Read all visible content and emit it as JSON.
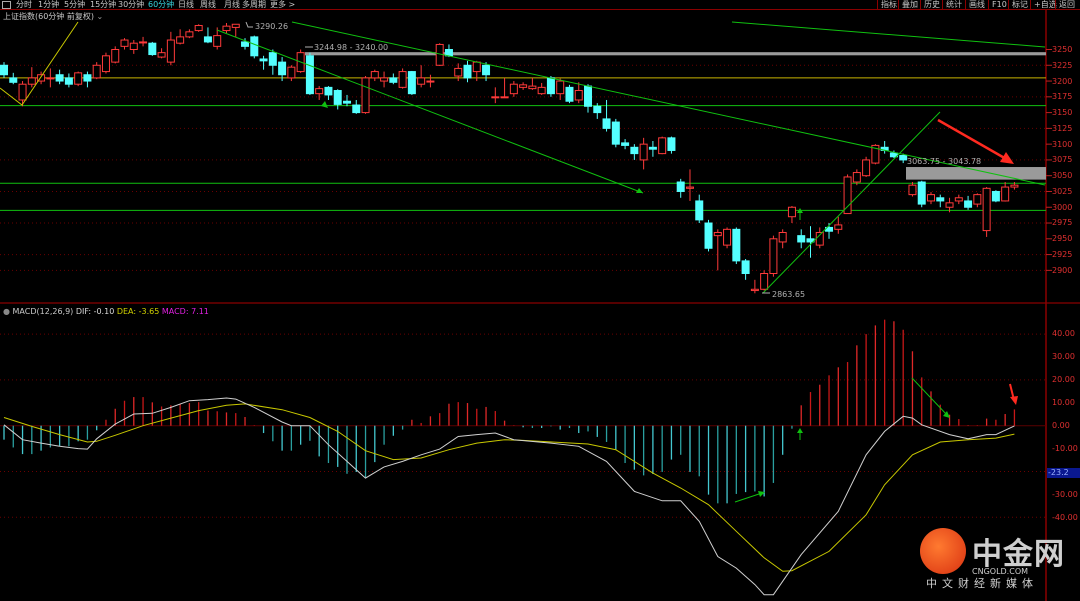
{
  "toolbar": {
    "tabs": [
      "分时",
      "1分钟",
      "5分钟",
      "15分钟",
      "30分钟",
      "60分钟",
      "日线",
      "周线",
      "月线",
      "多周期",
      "更多 >"
    ],
    "active_tab": "60分钟",
    "buttons": [
      "指标",
      "叠加",
      "历史",
      "统计",
      "画线",
      "F10",
      "标记",
      "+自选",
      "返回"
    ]
  },
  "title": "上证指数(60分钟 前复权)",
  "macd_legend": {
    "name": "MACD(12,26,9)",
    "dif": "DIF: -0.10",
    "dea": "DEA: -3.65",
    "macd": "MACD: 7.11"
  },
  "annotations": {
    "high": "3290.26",
    "band": "3244.98 - 3240.00",
    "box": "3063.75 - 3043.78",
    "low": "2863.65"
  },
  "price_axis": [
    "3250",
    "3225",
    "3200",
    "3175",
    "3150",
    "3125",
    "3100",
    "3075",
    "3050",
    "3025",
    "3000",
    "2975",
    "2950",
    "2925",
    "2900"
  ],
  "macd_axis": [
    "40.00",
    "30.00",
    "20.00",
    "10.00",
    "0.00",
    "-10.00",
    "-30.00",
    "-40.00"
  ],
  "macd_axis_highlight": "-23.2",
  "watermark": {
    "brand": "中金网",
    "site": "CNGOLD.COM",
    "slogan": "中文财经新媒体"
  },
  "colors": {
    "up": "#ff3a3a",
    "down": "#54ffff",
    "dif": "#d0d0d0",
    "dea": "#c8c800",
    "trend": "#10c010",
    "arrow": "#ff2a20"
  },
  "chart_data": [
    {
      "type": "candlestick",
      "title": "上证指数(60分钟 前复权)",
      "ylim": [
        2860,
        3300
      ],
      "ohlc_format": "[open, close, high, low]",
      "candles": [
        [
          3225,
          3210,
          3230,
          3205
        ],
        [
          3205,
          3198,
          3213,
          3195
        ],
        [
          3170,
          3195,
          3200,
          3160
        ],
        [
          3195,
          3205,
          3222,
          3190
        ],
        [
          3200,
          3210,
          3215,
          3195
        ],
        [
          3205,
          3205,
          3220,
          3190
        ],
        [
          3210,
          3200,
          3218,
          3195
        ],
        [
          3205,
          3195,
          3212,
          3190
        ],
        [
          3195,
          3213,
          3215,
          3192
        ],
        [
          3210,
          3200,
          3215,
          3190
        ],
        [
          3205,
          3225,
          3230,
          3203
        ],
        [
          3215,
          3240,
          3245,
          3212
        ],
        [
          3230,
          3250,
          3255,
          3228
        ],
        [
          3255,
          3265,
          3268,
          3250
        ],
        [
          3250,
          3260,
          3265,
          3243
        ],
        [
          3262,
          3262,
          3270,
          3255
        ],
        [
          3260,
          3242,
          3262,
          3240
        ],
        [
          3238,
          3245,
          3252,
          3236
        ],
        [
          3230,
          3265,
          3278,
          3225
        ],
        [
          3260,
          3270,
          3282,
          3258
        ],
        [
          3270,
          3278,
          3282,
          3268
        ],
        [
          3280,
          3288,
          3290,
          3278
        ],
        [
          3270,
          3262,
          3285,
          3260
        ],
        [
          3255,
          3272,
          3285,
          3250
        ],
        [
          3280,
          3287,
          3292,
          3276
        ],
        [
          3285,
          3290,
          3290.26,
          3270
        ],
        [
          3262,
          3255,
          3268,
          3250
        ],
        [
          3270,
          3240,
          3272,
          3236
        ],
        [
          3235,
          3232,
          3240,
          3218
        ],
        [
          3245,
          3225,
          3250,
          3210
        ],
        [
          3230,
          3210,
          3238,
          3200
        ],
        [
          3205,
          3222,
          3225,
          3200
        ],
        [
          3215,
          3245,
          3250,
          3213
        ],
        [
          3240,
          3180,
          3244.98,
          3178
        ],
        [
          3180,
          3188,
          3192,
          3170
        ],
        [
          3190,
          3178,
          3192,
          3170
        ],
        [
          3185,
          3163,
          3187,
          3155
        ],
        [
          3168,
          3165,
          3178,
          3160
        ],
        [
          3162,
          3150,
          3170,
          3148
        ],
        [
          3150,
          3205,
          3208,
          3148
        ],
        [
          3205,
          3215,
          3218,
          3200
        ],
        [
          3200,
          3205,
          3215,
          3190
        ],
        [
          3205,
          3198,
          3212,
          3195
        ],
        [
          3190,
          3215,
          3220,
          3188
        ],
        [
          3215,
          3180,
          3216,
          3178
        ],
        [
          3195,
          3205,
          3225,
          3190
        ],
        [
          3200,
          3200,
          3210,
          3190
        ],
        [
          3225,
          3258,
          3260,
          3224
        ],
        [
          3250,
          3240,
          3258,
          3238
        ],
        [
          3208,
          3220,
          3228,
          3200
        ],
        [
          3225,
          3205,
          3232,
          3198
        ],
        [
          3215,
          3230,
          3232,
          3200
        ],
        [
          3225,
          3210,
          3230,
          3200
        ],
        [
          3175,
          3175,
          3190,
          3165
        ],
        [
          3175,
          3175,
          3205,
          3175
        ],
        [
          3180,
          3195,
          3200,
          3175
        ],
        [
          3190,
          3194,
          3198,
          3186
        ],
        [
          3188,
          3192,
          3205,
          3186
        ],
        [
          3180,
          3190,
          3197,
          3178
        ],
        [
          3205,
          3180,
          3208,
          3175
        ],
        [
          3180,
          3200,
          3204,
          3170
        ],
        [
          3190,
          3168,
          3194,
          3165
        ],
        [
          3170,
          3185,
          3198,
          3165
        ],
        [
          3192,
          3160,
          3195,
          3150
        ],
        [
          3160,
          3150,
          3165,
          3140
        ],
        [
          3140,
          3125,
          3170,
          3120
        ],
        [
          3135,
          3100,
          3140,
          3095
        ],
        [
          3102,
          3098,
          3108,
          3092
        ],
        [
          3095,
          3085,
          3100,
          3075
        ],
        [
          3075,
          3100,
          3110,
          3060
        ],
        [
          3095,
          3092,
          3105,
          3080
        ],
        [
          3085,
          3110,
          3112,
          3084
        ],
        [
          3110,
          3090,
          3112,
          3085
        ],
        [
          3040,
          3025,
          3045,
          3015
        ],
        [
          3030,
          3032,
          3060,
          3010
        ],
        [
          3010,
          2980,
          3020,
          2975
        ],
        [
          2975,
          2935,
          2980,
          2930
        ],
        [
          2955,
          2960,
          2965,
          2900
        ],
        [
          2940,
          2965,
          2968,
          2935
        ],
        [
          2965,
          2915,
          2968,
          2910
        ],
        [
          2915,
          2895,
          2918,
          2885
        ],
        [
          2868,
          2870,
          2885,
          2863.65
        ],
        [
          2870,
          2895,
          2900,
          2868
        ],
        [
          2895,
          2950,
          2955,
          2890
        ],
        [
          2945,
          2960,
          2965,
          2935
        ],
        [
          2985,
          3000,
          3002,
          2975
        ],
        [
          2955,
          2945,
          2965,
          2935
        ],
        [
          2950,
          2945,
          2970,
          2920
        ],
        [
          2940,
          2960,
          2968,
          2935
        ],
        [
          2968,
          2962,
          2975,
          2950
        ],
        [
          2965,
          2972,
          2985,
          2958
        ],
        [
          2990,
          3048,
          3052,
          2990
        ],
        [
          3040,
          3055,
          3060,
          3035
        ],
        [
          3050,
          3075,
          3080,
          3048
        ],
        [
          3070,
          3098,
          3100,
          3068
        ],
        [
          3095,
          3090,
          3105,
          3085
        ],
        [
          3086,
          3080,
          3090,
          3078
        ],
        [
          3082,
          3075,
          3085,
          3070
        ],
        [
          3020,
          3035,
          3040,
          3017
        ],
        [
          3040,
          3005,
          3042,
          3000
        ],
        [
          3010,
          3020,
          3024,
          3005
        ],
        [
          3015,
          3010,
          3020,
          3000
        ],
        [
          3000,
          3007,
          3015,
          2992
        ],
        [
          3010,
          3015,
          3020,
          3005
        ],
        [
          3010,
          3000,
          3018,
          2996
        ],
        [
          3005,
          3020,
          3022,
          3000
        ],
        [
          2963,
          3030,
          3032,
          2953
        ],
        [
          3025,
          3010,
          3027,
          3008
        ],
        [
          3010,
          3032,
          3040,
          3009
        ],
        [
          3032,
          3035,
          3040,
          3028
        ]
      ],
      "horizontal_levels": [
        {
          "price": 3205,
          "color": "#c8b400"
        },
        {
          "price": 3161,
          "color": "#10c010"
        },
        {
          "price": 3038,
          "color": "#10c010"
        },
        {
          "price": 2995,
          "color": "#10c010"
        }
      ],
      "zones": [
        {
          "from": 3240.0,
          "to": 3244.98,
          "color": "#9a9a9a"
        },
        {
          "from": 3043.78,
          "to": 3063.75,
          "color": "#9a9a9a"
        }
      ]
    },
    {
      "type": "macd",
      "title": "MACD(12,26,9)",
      "ylim": [
        -50,
        50
      ],
      "histogram": [
        -6.1,
        -9.5,
        -12.4,
        -12.4,
        -10.9,
        -9.5,
        -9,
        -9,
        -6.8,
        -6.1,
        -2,
        2.6,
        7.4,
        10.9,
        12.5,
        12.5,
        10.2,
        8.4,
        8.9,
        9.5,
        9.9,
        10.3,
        6.6,
        6.3,
        5.8,
        5.5,
        3.8,
        0.2,
        -3.2,
        -6.8,
        -10.9,
        -10.9,
        -8.3,
        -6.6,
        -13.4,
        -16.3,
        -18,
        -21,
        -20.2,
        -22.6,
        -15.9,
        -8.3,
        -4.4,
        -1.7,
        2.6,
        1.2,
        4.1,
        5.5,
        9.6,
        10.3,
        9.9,
        7.4,
        8.2,
        6.4,
        2.2,
        0.2,
        -0.7,
        -1,
        -1,
        -0.3,
        -1.7,
        -1,
        -3.2,
        -2.5,
        -4.9,
        -7.1,
        -10.5,
        -16.3,
        -19.2,
        -21.7,
        -21.1,
        -20.2,
        -14.8,
        -12.7,
        -20.2,
        -22.1,
        -30.1,
        -33.9,
        -33.9,
        -29.8,
        -29,
        -28.7,
        -30.9,
        -25,
        -12.7,
        -1.3,
        8.9,
        14.7,
        17.9,
        22,
        25.5,
        27.8,
        35.1,
        40,
        43.8,
        46.3,
        45.6,
        41.9,
        32.5,
        21.1,
        15,
        9.2,
        4.8,
        2.9,
        0.2,
        0.2,
        3.1,
        2.6,
        5.1,
        7.11
      ],
      "dif": [
        [
          0,
          0.4
        ],
        [
          2,
          -6.1
        ],
        [
          4,
          -7.6
        ],
        [
          6,
          -9
        ],
        [
          8,
          -10
        ],
        [
          9,
          -10.2
        ],
        [
          10,
          -5.7
        ],
        [
          12,
          0.7
        ],
        [
          14,
          5.1
        ],
        [
          16,
          5.4
        ],
        [
          18,
          8
        ],
        [
          20,
          10.9
        ],
        [
          22,
          11.4
        ],
        [
          24,
          12.1
        ],
        [
          25,
          11.6
        ],
        [
          27,
          8
        ],
        [
          30,
          1.6
        ],
        [
          31,
          0
        ],
        [
          33,
          0
        ],
        [
          35,
          -8.3
        ],
        [
          37,
          -15.6
        ],
        [
          39,
          -22.9
        ],
        [
          41,
          -18
        ],
        [
          43,
          -15.6
        ],
        [
          45,
          -12.7
        ],
        [
          47,
          -10.2
        ],
        [
          49,
          -4.7
        ],
        [
          51,
          -3.9
        ],
        [
          53,
          -3.2
        ],
        [
          55,
          -6.1
        ],
        [
          59,
          -7.6
        ],
        [
          62,
          -9
        ],
        [
          65,
          -15.6
        ],
        [
          68,
          -28.7
        ],
        [
          71,
          -32.8
        ],
        [
          73,
          -32.8
        ],
        [
          75,
          -41.8
        ],
        [
          77,
          -57.1
        ],
        [
          79,
          -62.2
        ],
        [
          81,
          -69.4
        ],
        [
          82,
          -73.8
        ],
        [
          83,
          -73.8
        ],
        [
          86,
          -56.3
        ],
        [
          90,
          -37.4
        ],
        [
          93,
          -12.7
        ],
        [
          95,
          -2.5
        ],
        [
          97,
          4.1
        ],
        [
          98,
          3.3
        ],
        [
          99,
          0.4
        ],
        [
          102,
          -3.9
        ],
        [
          104,
          -5.7
        ],
        [
          106,
          -3.9
        ],
        [
          107,
          -3.9
        ],
        [
          109,
          -0.1
        ]
      ],
      "dea": [
        [
          0,
          3.6
        ],
        [
          3,
          -0.3
        ],
        [
          6,
          -3.9
        ],
        [
          9,
          -7.1
        ],
        [
          10,
          -6.8
        ],
        [
          12,
          -4.2
        ],
        [
          15,
          0
        ],
        [
          18,
          3.3
        ],
        [
          21,
          6.6
        ],
        [
          24,
          8.9
        ],
        [
          26,
          9.5
        ],
        [
          30,
          7
        ],
        [
          33,
          3.6
        ],
        [
          36,
          -2.5
        ],
        [
          39,
          -10.9
        ],
        [
          42,
          -14.8
        ],
        [
          45,
          -14.1
        ],
        [
          48,
          -10.5
        ],
        [
          51,
          -7.6
        ],
        [
          54,
          -6.1
        ],
        [
          56,
          -6.4
        ],
        [
          63,
          -8
        ],
        [
          66,
          -10.5
        ],
        [
          70,
          -20.7
        ],
        [
          73,
          -27.2
        ],
        [
          76,
          -34.5
        ],
        [
          79,
          -46.1
        ],
        [
          82,
          -57.7
        ],
        [
          84,
          -63.6
        ],
        [
          85,
          -63.3
        ],
        [
          89,
          -54.9
        ],
        [
          93,
          -38.9
        ],
        [
          95,
          -25.8
        ],
        [
          98,
          -12.7
        ],
        [
          101,
          -7.1
        ],
        [
          104,
          -6.1
        ],
        [
          107,
          -5.4
        ],
        [
          109,
          -3.65
        ]
      ]
    }
  ]
}
